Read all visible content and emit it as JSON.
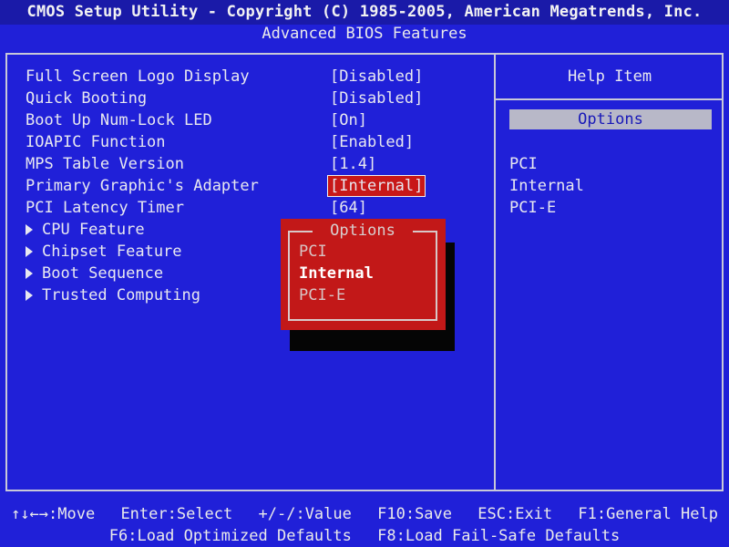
{
  "header": {
    "title": "CMOS Setup Utility - Copyright (C) 1985-2005, American Megatrends, Inc.",
    "subtitle": "Advanced BIOS Features"
  },
  "settings": [
    {
      "label": "Full Screen Logo Display",
      "value": "[Disabled]"
    },
    {
      "label": "Quick Booting",
      "value": "[Disabled]"
    },
    {
      "label": "Boot Up Num-Lock LED",
      "value": "[On]"
    },
    {
      "label": "IOAPIC Function",
      "value": "[Enabled]"
    },
    {
      "label": "MPS Table Version",
      "value": "[1.4]"
    },
    {
      "label": "Primary Graphic's Adapter",
      "value": "[Internal]"
    },
    {
      "label": "PCI Latency Timer",
      "value": "[64]"
    }
  ],
  "submenus": [
    {
      "label": "CPU Feature"
    },
    {
      "label": "Chipset Feature"
    },
    {
      "label": "Boot Sequence"
    },
    {
      "label": "Trusted Computing"
    }
  ],
  "help": {
    "title": "Help Item",
    "options_label": "Options",
    "items": [
      "PCI",
      "Internal",
      "PCI-E"
    ]
  },
  "popup": {
    "title": "Options",
    "options": [
      "PCI",
      "Internal",
      "PCI-E"
    ],
    "selected": "Internal"
  },
  "footer": {
    "row1": [
      "↑↓←→:Move",
      "Enter:Select",
      "+/-/:Value",
      "F10:Save",
      "ESC:Exit",
      "F1:General Help"
    ],
    "row2": [
      "F6:Load Optimized Defaults",
      "F8:Load Fail-Safe Defaults"
    ]
  },
  "colors": {
    "background": "#2020d8",
    "highlight": "#c81818",
    "text": "#e8e8f0"
  }
}
